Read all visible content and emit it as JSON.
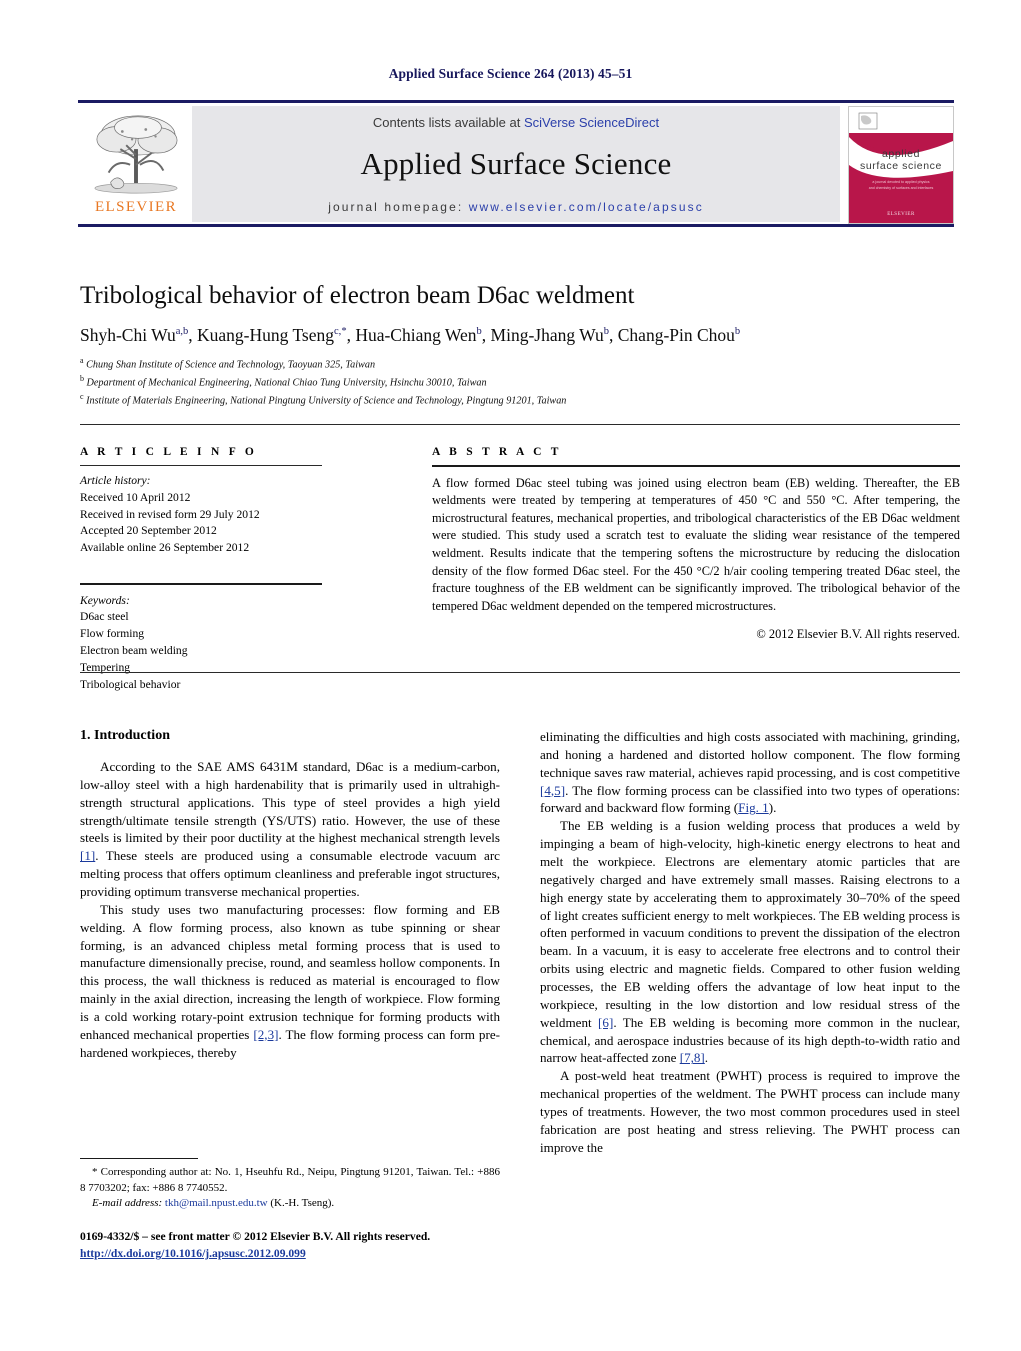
{
  "running_head": "Applied Surface Science 264 (2013) 45–51",
  "masthead": {
    "contents_prefix": "Contents lists available at ",
    "contents_link": "SciVerse ScienceDirect",
    "journal_title": "Applied Surface Science",
    "homepage_prefix": "journal homepage: ",
    "homepage_link": "www.elsevier.com/locate/apsusc",
    "publisher_name": "ELSEVIER",
    "publisher_logo_icon": "elsevier-tree-icon",
    "cover_title_line1": "applied",
    "cover_title_line2": "surface science",
    "cover_subtitle": "a journal devoted to applied physics and chemistry of surfaces and interfaces",
    "cover_footer": "ELSEVIER",
    "brand_orange": "#e87722",
    "brand_navy": "#1b1b63",
    "link_blue": "#2b3faa",
    "cover_crimson": "#b8164a"
  },
  "article": {
    "title": "Tribological behavior of electron beam D6ac weldment",
    "authors_html": "Shyh-Chi Wu<sup>a,b</sup>, Kuang-Hung Tseng<sup>c,</sup><sup>*</sup>, Hua-Chiang Wen<sup>b</sup>, Ming-Jhang Wu<sup>b</sup>, Chang-Pin Chou<sup>b</sup>",
    "affiliations": [
      {
        "marker": "a",
        "text": "Chung Shan Institute of Science and Technology, Taoyuan 325, Taiwan"
      },
      {
        "marker": "b",
        "text": "Department of Mechanical Engineering, National Chiao Tung University, Hsinchu 30010, Taiwan"
      },
      {
        "marker": "c",
        "text": "Institute of Materials Engineering, National Pingtung University of Science and Technology, Pingtung 91201, Taiwan"
      }
    ]
  },
  "article_info": {
    "heading": "A R T I C L E   I N F O",
    "history_label": "Article history:",
    "history": [
      "Received 10 April 2012",
      "Received in revised form 29 July 2012",
      "Accepted 20 September 2012",
      "Available online 26 September 2012"
    ],
    "keywords_label": "Keywords:",
    "keywords": [
      "D6ac steel",
      "Flow forming",
      "Electron beam welding",
      "Tempering",
      "Tribological behavior"
    ]
  },
  "abstract": {
    "heading": "A B S T R A C T",
    "text": "A flow formed D6ac steel tubing was joined using electron beam (EB) welding. Thereafter, the EB weldments were treated by tempering at temperatures of 450 °C and 550 °C. After tempering, the microstructural features, mechanical properties, and tribological characteristics of the EB D6ac weldment were studied. This study used a scratch test to evaluate the sliding wear resistance of the tempered weldment. Results indicate that the tempering softens the microstructure by reducing the dislocation density of the flow formed D6ac steel. For the 450 °C/2 h/air cooling tempering treated D6ac steel, the fracture toughness of the EB weldment can be significantly improved. The tribological behavior of the tempered D6ac weldment depended on the tempered microstructures.",
    "copyright": "© 2012 Elsevier B.V. All rights reserved."
  },
  "body": {
    "section_heading": "1. Introduction",
    "left_paragraphs": [
      {
        "segments": [
          {
            "t": "According to the SAE AMS 6431M standard, D6ac is a medium-carbon, low-alloy steel with a high hardenability that is primarily used in ultrahigh-strength structural applications. This type of steel provides a high yield strength/ultimate tensile strength (YS/UTS) ratio. However, the use of these steels is limited by their poor ductility at the highest mechanical strength levels "
          },
          {
            "t": "[1]",
            "ref": true
          },
          {
            "t": ". These steels are produced using a consumable electrode vacuum arc melting process that offers optimum cleanliness and preferable ingot structures, providing optimum transverse mechanical properties."
          }
        ]
      },
      {
        "segments": [
          {
            "t": "This study uses two manufacturing processes: flow forming and EB welding. A flow forming process, also known as tube spinning or shear forming, is an advanced chipless metal forming process that is used to manufacture dimensionally precise, round, and seamless hollow components. In this process, the wall thickness is reduced as material is encouraged to flow mainly in the axial direction, increasing the length of workpiece. Flow forming is a cold working rotary-point extrusion technique for forming products with enhanced mechanical properties "
          },
          {
            "t": "[2,3]",
            "ref": true
          },
          {
            "t": ". The flow forming process can form pre-hardened workpieces, thereby"
          }
        ]
      }
    ],
    "right_paragraphs": [
      {
        "continued": true,
        "segments": [
          {
            "t": "eliminating the difficulties and high costs associated with machining, grinding, and honing a hardened and distorted hollow component. The flow forming technique saves raw material, achieves rapid processing, and is cost competitive "
          },
          {
            "t": "[4,5]",
            "ref": true
          },
          {
            "t": ". The flow forming process can be classified into two types of operations: forward and backward flow forming ("
          },
          {
            "t": "Fig. 1",
            "ref": true
          },
          {
            "t": ")."
          }
        ]
      },
      {
        "segments": [
          {
            "t": "The EB welding is a fusion welding process that produces a weld by impinging a beam of high-velocity, high-kinetic energy electrons to heat and melt the workpiece. Electrons are elementary atomic particles that are negatively charged and have extremely small masses. Raising electrons to a high energy state by accelerating them to approximately 30–70% of the speed of light creates sufficient energy to melt workpieces. The EB welding process is often performed in vacuum conditions to prevent the dissipation of the electron beam. In a vacuum, it is easy to accelerate free electrons and to control their orbits using electric and magnetic fields. Compared to other fusion welding processes, the EB welding offers the advantage of low heat input to the workpiece, resulting in the low distortion and low residual stress of the weldment "
          },
          {
            "t": "[6]",
            "ref": true
          },
          {
            "t": ". The EB welding is becoming more common in the nuclear, chemical, and aerospace industries because of its high depth-to-width ratio and narrow heat-affected zone "
          },
          {
            "t": "[7,8]",
            "ref": true
          },
          {
            "t": "."
          }
        ]
      },
      {
        "segments": [
          {
            "t": "A post-weld heat treatment (PWHT) process is required to improve the mechanical properties of the weldment. The PWHT process can include many types of treatments. However, the two most common procedures used in steel fabrication are post heating and stress relieving. The PWHT process can improve the"
          }
        ]
      }
    ]
  },
  "footnote": {
    "corresponding": "* Corresponding author at: No. 1, Hseuhfu Rd., Neipu, Pingtung 91201, Taiwan. Tel.: +886 8 7703202; fax: +886 8 7740552.",
    "email_label": "E-mail address:",
    "email": "tkh@mail.npust.edu.tw",
    "email_owner": "(K.-H. Tseng)."
  },
  "imprint": {
    "line1": "0169-4332/$ – see front matter © 2012 Elsevier B.V. All rights reserved.",
    "doi": "http://dx.doi.org/10.1016/j.apsusc.2012.09.099"
  }
}
